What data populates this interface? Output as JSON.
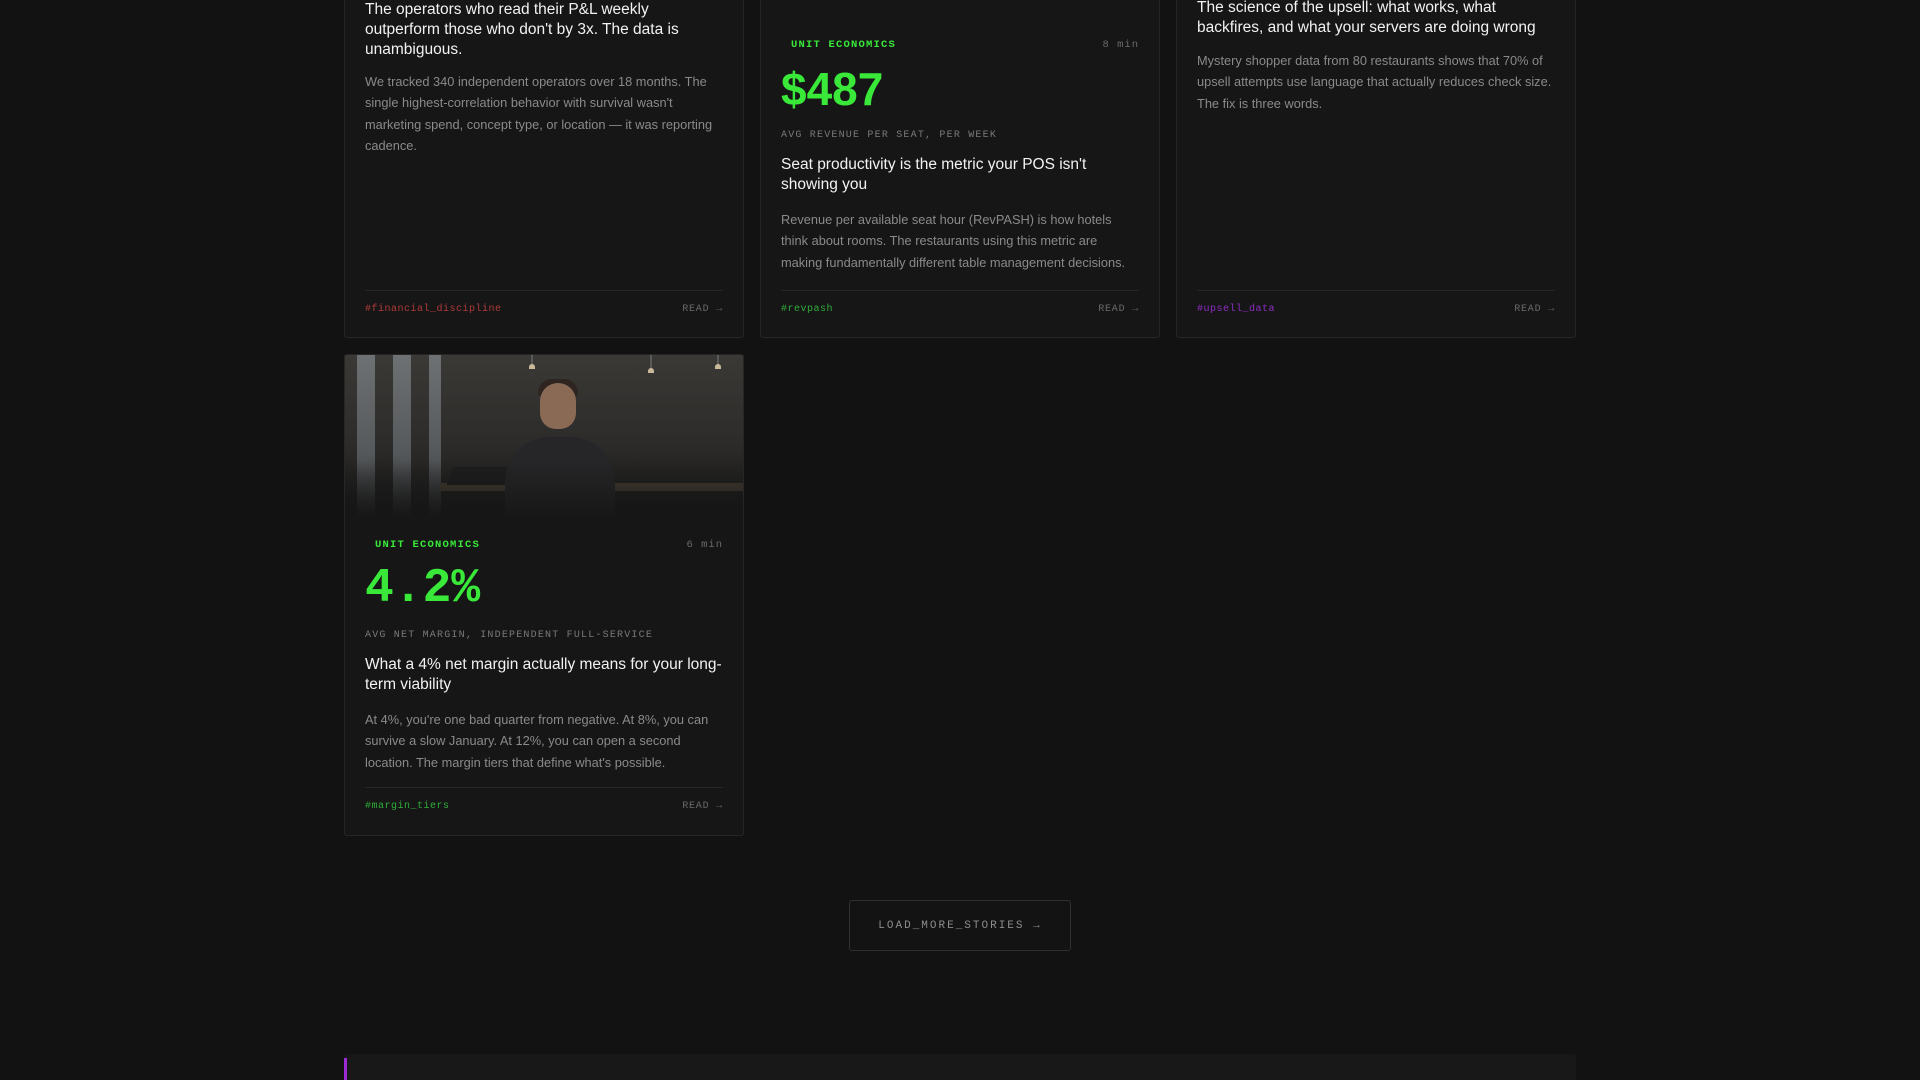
{
  "colors": {
    "accent_green": "#39e839",
    "tag_red": "#b33a3a",
    "tag_green": "#2fae3a",
    "tag_purple": "#8e2cc4",
    "section_accent": "#9b2bd6"
  },
  "cards": {
    "financial": {
      "headline": "The operators who read their P&L weekly outperform those who don't by 3x. The data is unambiguous.",
      "excerpt": "We tracked 340 independent operators over 18 months. The single highest-correlation behavior with survival wasn't marketing spend, concept type, or location — it was reporting cadence.",
      "tag": "#financial_discipline",
      "read": "READ →"
    },
    "revpash": {
      "category": "UNIT ECONOMICS",
      "read_time": "8 min",
      "stat": "$487",
      "stat_caption": "AVG REVENUE PER SEAT, PER WEEK",
      "headline": "Seat productivity is the metric your POS isn't showing you",
      "excerpt": "Revenue per available seat hour (RevPASH) is how hotels think about rooms. The restaurants using this metric are making fundamentally different table management decisions.",
      "tag": "#revpash",
      "read": "READ →"
    },
    "upsell": {
      "headline": "The science of the upsell: what works, what backfires, and what your servers are doing wrong",
      "excerpt": "Mystery shopper data from 80 restaurants shows that 70% of upsell attempts use language that actually reduces check size. The fix is three words.",
      "tag": "#upsell_data",
      "read": "READ →"
    },
    "margin": {
      "category": "UNIT ECONOMICS",
      "read_time": "6 min",
      "stat": "4.2%",
      "stat_caption": "AVG NET MARGIN, INDEPENDENT FULL-SERVICE",
      "headline": "What a 4% net margin actually means for your long-term viability",
      "excerpt": "At 4%, you're one bad quarter from negative. At 8%, you can survive a slow January. At 12%, you can open a second location. The margin tiers that define what's possible.",
      "tag": "#margin_tiers",
      "read": "READ →"
    }
  },
  "load_more": "LOAD_MORE_STORIES →"
}
